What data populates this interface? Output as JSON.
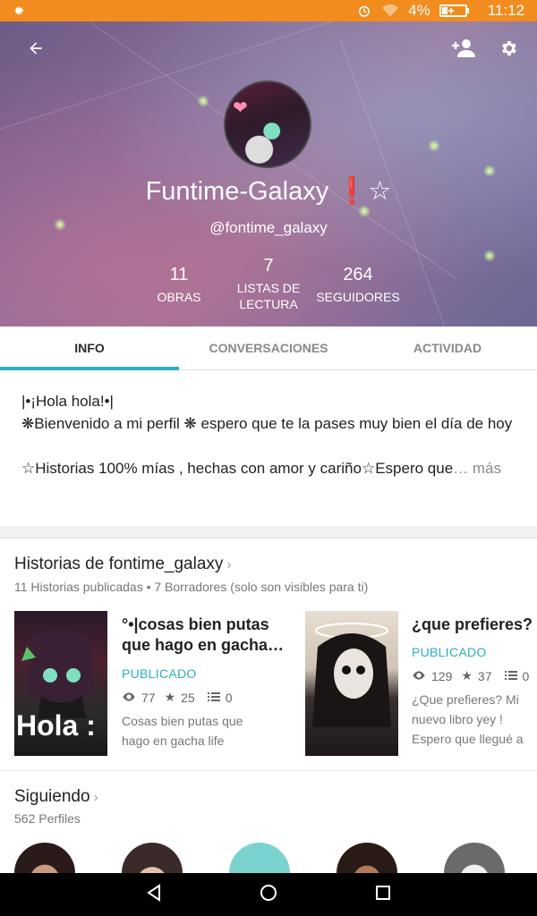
{
  "status_bar": {
    "battery_percent": "4%",
    "time": "11:12"
  },
  "profile": {
    "display_name": "Funtime-Galaxy ❗☆",
    "username": "@fontime_galaxy",
    "stats": [
      {
        "value": "11",
        "label": "OBRAS"
      },
      {
        "value": "7",
        "label": "LISTAS DE LECTURA"
      },
      {
        "value": "264",
        "label": "SEGUIDORES"
      }
    ]
  },
  "tabs": [
    {
      "label": "INFO",
      "active": true
    },
    {
      "label": "CONVERSACIONES",
      "active": false
    },
    {
      "label": "ACTIVIDAD",
      "active": false
    }
  ],
  "about": {
    "line1": "|•¡Hola hola!•|",
    "line2": "❋Bienvenido a mi perfil ❋ espero que te la pases muy bien el día de hoy",
    "line3": "☆Historias 100% mías , hechas con amor y cariño☆Espero que",
    "more": "… más"
  },
  "stories": {
    "title": "Historias de fontime_galaxy",
    "subtitle": "11 Historias publicadas • 7 Borradores (solo son visibles para ti)",
    "items": [
      {
        "title": "°•|cosas bien putas que hago en gacha…",
        "status": "PUBLICADO",
        "reads": "77",
        "votes": "25",
        "parts": "0",
        "description": "Cosas bien putas que hago en gacha life",
        "cover_text": "Hola :"
      },
      {
        "title": "¿que prefieres?",
        "status": "PUBLICADO",
        "reads": "129",
        "votes": "37",
        "parts": "0",
        "description": "¿Que prefieres? Mi nuevo libro yey ! Espero que llegué a"
      }
    ]
  },
  "following": {
    "title": "Siguiendo",
    "count": "562 Perfiles"
  },
  "colors": {
    "status_bar": "#f28c1e",
    "accent": "#2eaec0"
  }
}
